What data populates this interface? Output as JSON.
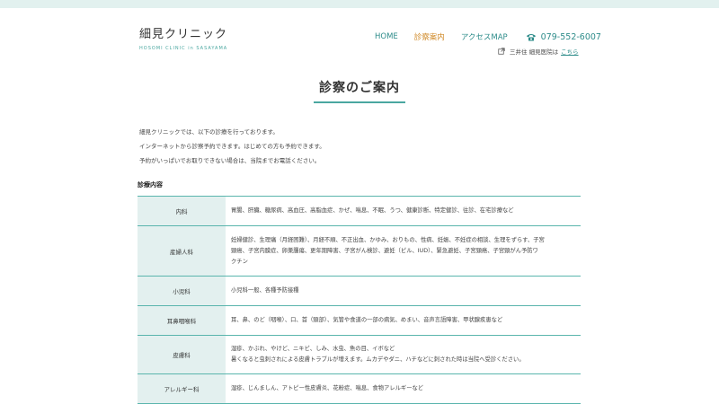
{
  "header": {
    "logo_title": "細見クリニック",
    "logo_sub": "HOSOMI CLINIC in SASAYAMA",
    "nav": [
      "HOME",
      "診察案内",
      "アクセスMAP"
    ],
    "active_nav": "診察案内",
    "phone": "079-552-6007",
    "subnote_text": "三井住 細見医院は",
    "subnote_link": "こちら"
  },
  "page": {
    "title": "診察のご案内"
  },
  "intro": {
    "line1": "細見クリニックでは、以下の診療を行っております。",
    "line2": "インターネットから診察予約できます。はじめての方も予約できます。",
    "line3": "予約がいっぱいでお取りできない場合は、当院までお電話ください。"
  },
  "section": {
    "label": "診療内容"
  },
  "rows": [
    {
      "head": "内科",
      "lines": [
        "胃腸、肝臓、糖尿病、高血圧、高脂血症、かぜ、喘息、不眠、うつ、健康診断、特定健診、往診、在宅診療など"
      ],
      "h": 33
    },
    {
      "head": "産婦人科",
      "lines": [
        "妊婦健診、生理痛（月経困難）、月経不順、不正出血、かゆみ、おりもの、性病、妊娠、不妊症の相談、生理をずらす、子宮",
        "頸癌、子宮内膜症、卵巣腫瘍、更年期障害、子宮がん検診、避妊（ピル、IUD）、緊急避妊、子宮頸癌、子宮頸がん予防ワ",
        "クチン"
      ],
      "h": 56
    },
    {
      "head": "小児科",
      "lines": [
        "小児科一般、各種予防接種"
      ],
      "h": 33
    },
    {
      "head": "耳鼻咽喉科",
      "lines": [
        "耳、鼻、のど（咽喉）、口、首（頸部）、気管や食道の一部の病気、めまい、音声言語障害、甲状腺疾患など"
      ],
      "h": 33
    },
    {
      "head": "皮膚科",
      "lines": [
        "湿疹、かぶれ、やけど、ニキビ、しみ、水虫、魚の目、イボなど",
        "暑くなると虫刺されによる皮膚トラブルが増えます。ムカデやダニ、ハチなどに刺された時は当院へ受診ください。"
      ],
      "h": 43
    },
    {
      "head": "アレルギー科",
      "lines": [
        "湿疹、じんましん、アトピー性皮膚炎、花粉症、喘息、食物アレルギーなど"
      ],
      "h": 33
    }
  ],
  "colors": {
    "accent": "#4aa7a0",
    "nav": "#2e8c8a",
    "active": "#d08a28",
    "head_bg": "#e3f0ef"
  }
}
